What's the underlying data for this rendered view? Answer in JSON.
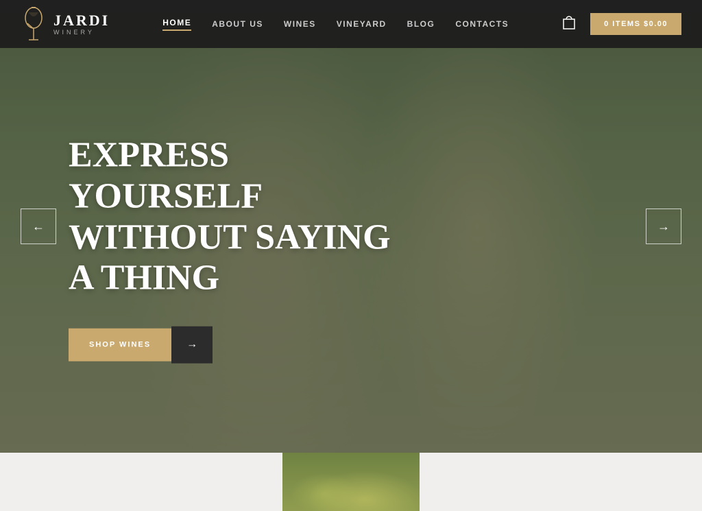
{
  "logo": {
    "name": "JARDI",
    "sub": "WINERY"
  },
  "nav": {
    "items": [
      {
        "label": "HOME",
        "active": true
      },
      {
        "label": "ABOUT US",
        "active": false
      },
      {
        "label": "WINES",
        "active": false
      },
      {
        "label": "VINEYARD",
        "active": false
      },
      {
        "label": "BLOG",
        "active": false
      },
      {
        "label": "CONTACTS",
        "active": false
      }
    ]
  },
  "cart": {
    "label": "0 ITEMS $0.00",
    "icon": "🛍"
  },
  "hero": {
    "title_line1": "EXPRESS YOURSELF",
    "title_line2": "WITHOUT SAYING",
    "title_line3": "A THING",
    "cta_label": "SHOP WINES",
    "arrow_left": "←",
    "arrow_right": "→"
  }
}
